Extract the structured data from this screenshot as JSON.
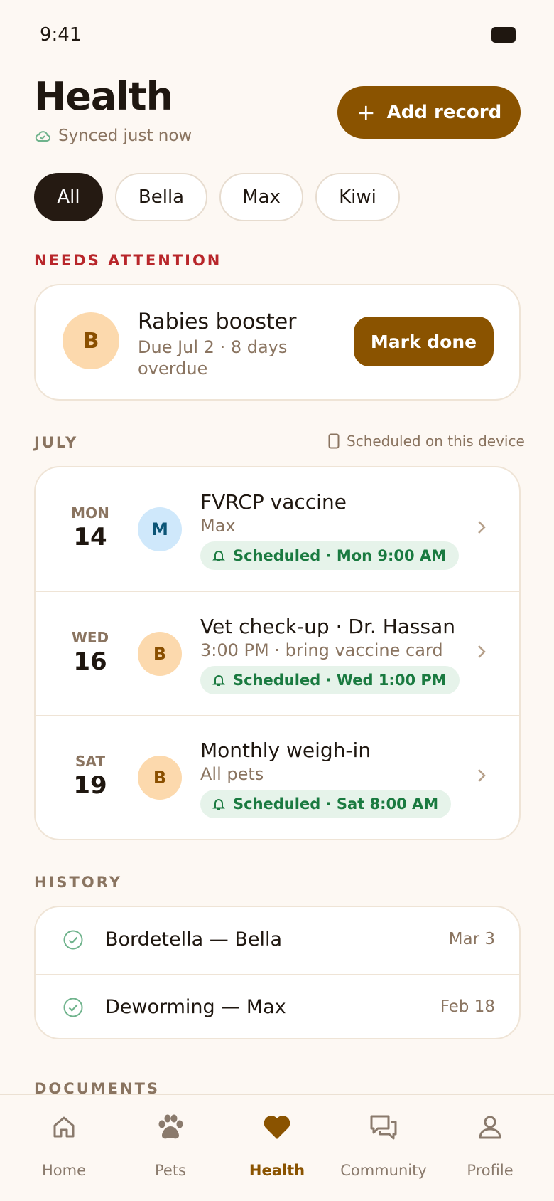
{
  "status": {
    "time": "9:41"
  },
  "header": {
    "title": "Health",
    "sync_text": "Synced just now",
    "add_label": "Add record"
  },
  "filters": [
    "All",
    "Bella",
    "Max",
    "Kiwi"
  ],
  "needs_attention": {
    "label": "NEEDS ATTENTION",
    "item": {
      "avatar": "B",
      "title": "Rabies booster",
      "subtitle": "Due Jul 2 · 8 days overdue",
      "action": "Mark done"
    }
  },
  "schedule": {
    "month": "JULY",
    "device_note": "Scheduled on this device",
    "events": [
      {
        "day": "MON",
        "date": "14",
        "avatar": "M",
        "title": "FVRCP vaccine",
        "subtitle": "Max",
        "reminder": "Scheduled · Mon 9:00 AM"
      },
      {
        "day": "WED",
        "date": "16",
        "avatar": "B",
        "title": "Vet check-up · Dr. Hassan",
        "subtitle": "3:00 PM · bring vaccine card",
        "reminder": "Scheduled · Wed 1:00 PM"
      },
      {
        "day": "SAT",
        "date": "19",
        "avatar": "B",
        "title": "Monthly weigh-in",
        "subtitle": "All pets",
        "reminder": "Scheduled · Sat 8:00 AM"
      }
    ]
  },
  "history": {
    "label": "HISTORY",
    "items": [
      {
        "title": "Bordetella — Bella",
        "date": "Mar 3"
      },
      {
        "title": "Deworming — Max",
        "date": "Feb 18"
      }
    ]
  },
  "documents": {
    "label": "DOCUMENTS"
  },
  "tabs": [
    "Home",
    "Pets",
    "Health",
    "Community",
    "Profile"
  ],
  "colors": {
    "accent": "#8a5300",
    "alert": "#b8262a",
    "success": "#1a7a40",
    "background": "#fdf8f3"
  }
}
